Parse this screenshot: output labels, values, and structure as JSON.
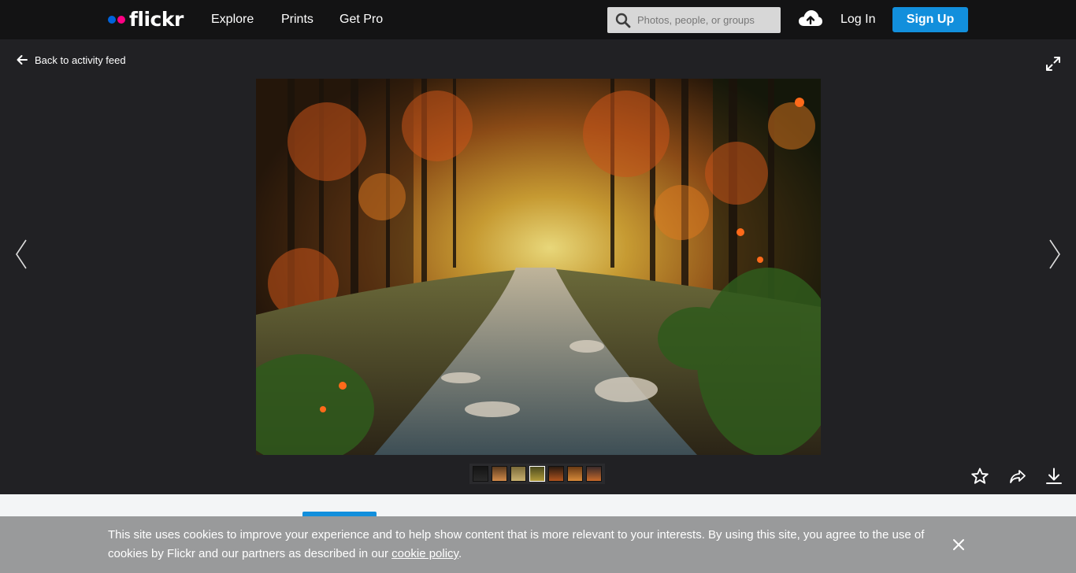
{
  "header": {
    "logo_text": "flickr",
    "nav": [
      "Explore",
      "Prints",
      "Get Pro"
    ],
    "search_placeholder": "Photos, people, or groups",
    "login_label": "Log In",
    "signup_label": "Sign Up"
  },
  "viewer": {
    "back_label": "Back to activity feed",
    "thumbnail_count": 7,
    "active_thumbnail": 4
  },
  "cookie_banner": {
    "text": "This site uses cookies to improve your experience and to help show content that is more relevant to your interests. By using this site, you agree to the use of cookies by Flickr and our partners as described in our ",
    "link_text": "cookie policy",
    "suffix": "."
  },
  "colors": {
    "brand_blue": "#0063dc",
    "brand_pink": "#ff0084",
    "button_blue": "#128fdc"
  },
  "icons": [
    "search-icon",
    "upload-cloud-icon",
    "back-arrow-icon",
    "fullscreen-icon",
    "chevron-left-icon",
    "chevron-right-icon",
    "star-icon",
    "share-icon",
    "download-icon",
    "close-icon"
  ]
}
